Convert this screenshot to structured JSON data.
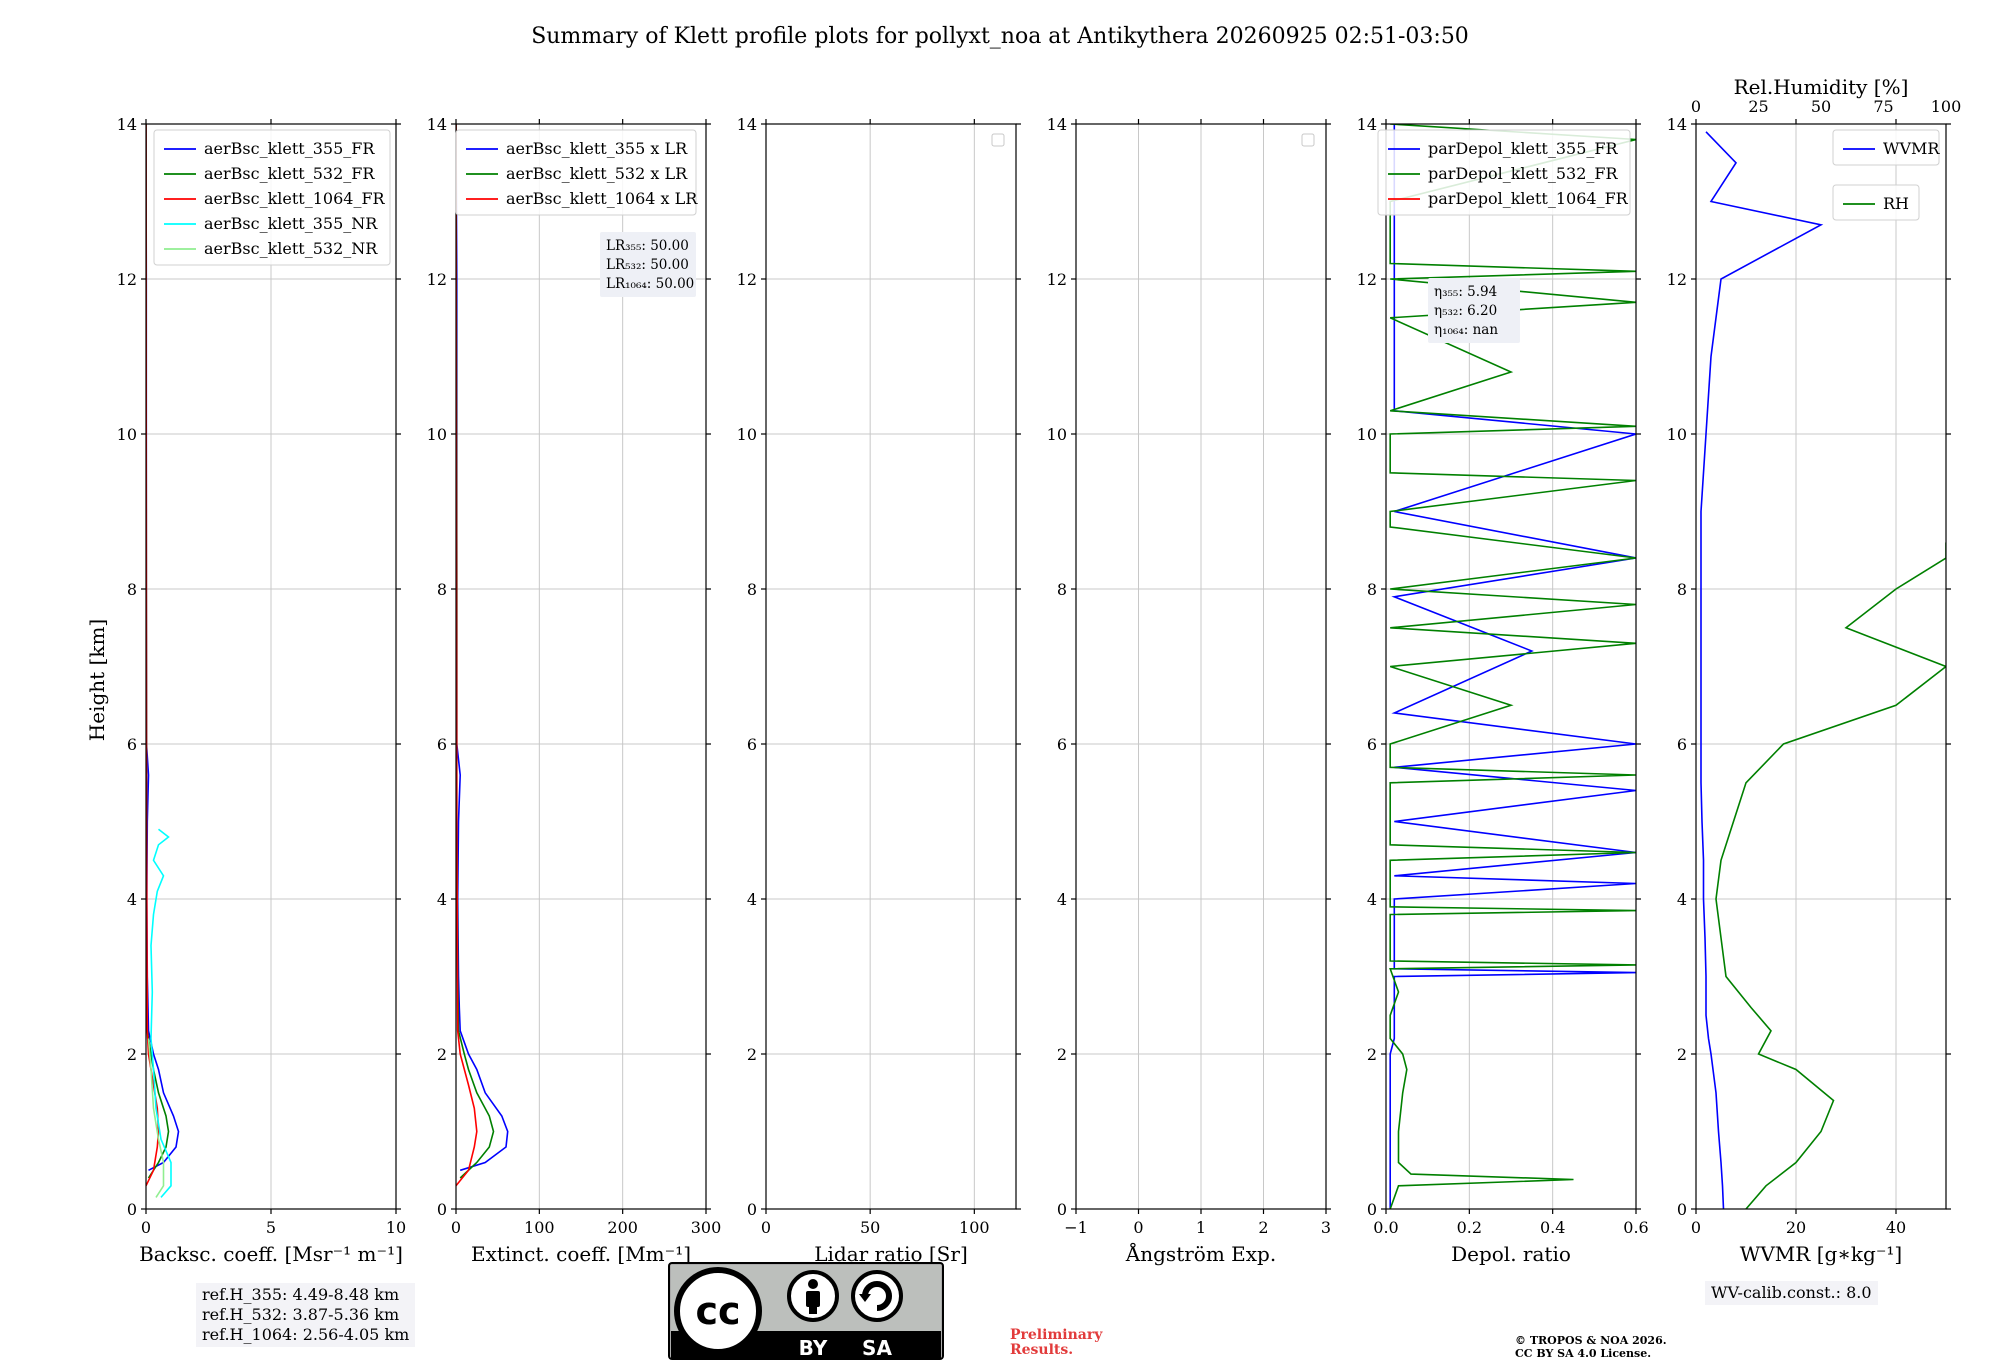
{
  "title": "Summary of Klett profile plots for pollyxt_noa at Antikythera 20260925 02:51-03:50",
  "colors": {
    "b355": "#0000ff",
    "g532": "#008000",
    "r1064": "#ff0000",
    "c355nr": "#00ffff",
    "lg532nr": "#90ee90"
  },
  "chart_data": [
    {
      "type": "line",
      "id": "backscatter",
      "xlabel": "Backsc. coeff. [Msr⁻¹ m⁻¹]",
      "ylabel": "Height [km]",
      "xlim": [
        0,
        10
      ],
      "ylim": [
        0,
        14
      ],
      "xticks": [
        0,
        5,
        10
      ],
      "xtick_labels": [
        "0",
        "5",
        "10"
      ],
      "yticks": [
        0,
        2,
        4,
        6,
        8,
        10,
        12,
        14
      ],
      "ytick_labels": [
        "0",
        "2",
        "4",
        "6",
        "8",
        "10",
        "12",
        "14"
      ],
      "grid": true,
      "legend_position": "top-right",
      "series": [
        {
          "name": "aerBsc_klett_355_FR",
          "color": "#0000ff",
          "y": [
            0.5,
            0.6,
            0.8,
            1.0,
            1.2,
            1.5,
            1.8,
            2.0,
            2.3,
            2.6,
            3.0,
            4.0,
            5.0,
            5.6,
            6.0,
            8.0,
            10.0,
            12.0,
            14.0
          ],
          "x": [
            0.1,
            0.7,
            1.2,
            1.3,
            1.1,
            0.7,
            0.5,
            0.3,
            0.1,
            0.08,
            0.05,
            0.03,
            0.05,
            0.1,
            0.02,
            0.01,
            0.01,
            0.01,
            0.0
          ]
        },
        {
          "name": "aerBsc_klett_532_FR",
          "color": "#008000",
          "y": [
            0.4,
            0.6,
            0.8,
            1.0,
            1.2,
            1.5,
            1.8,
            2.0,
            2.3,
            3.0,
            5.0,
            8.0,
            14.0
          ],
          "x": [
            0.1,
            0.5,
            0.8,
            0.9,
            0.8,
            0.5,
            0.3,
            0.2,
            0.05,
            0.03,
            0.02,
            0.01,
            0.0
          ]
        },
        {
          "name": "aerBsc_klett_1064_FR",
          "color": "#ff0000",
          "y": [
            0.3,
            0.5,
            0.8,
            1.0,
            1.3,
            1.6,
            2.0,
            2.3,
            5.0,
            14.0
          ],
          "x": [
            0.0,
            0.3,
            0.45,
            0.5,
            0.45,
            0.3,
            0.1,
            0.05,
            0.02,
            0.0
          ]
        },
        {
          "name": "aerBsc_klett_355_NR",
          "color": "#00ffff",
          "y": [
            0.15,
            0.3,
            0.6,
            0.9,
            1.3,
            1.8,
            2.2,
            2.8,
            3.4,
            3.8,
            4.1,
            4.3,
            4.5,
            4.7,
            4.8,
            4.9
          ],
          "x": [
            0.6,
            1.0,
            1.0,
            0.6,
            0.4,
            0.3,
            0.2,
            0.25,
            0.2,
            0.3,
            0.45,
            0.7,
            0.3,
            0.5,
            0.9,
            0.5
          ]
        },
        {
          "name": "aerBsc_klett_532_NR",
          "color": "#90ee90",
          "y": [
            0.15,
            0.3,
            0.6,
            0.9,
            1.3,
            1.8,
            2.2
          ],
          "x": [
            0.4,
            0.7,
            0.7,
            0.5,
            0.3,
            0.2,
            0.1
          ]
        }
      ]
    },
    {
      "type": "line",
      "id": "extinction",
      "xlabel": "Extinct. coeff. [Mm⁻¹]",
      "xlim": [
        0,
        300
      ],
      "ylim": [
        0,
        14
      ],
      "xticks": [
        0,
        100,
        200,
        300
      ],
      "xtick_labels": [
        "0",
        "100",
        "200",
        "300"
      ],
      "yticks": [
        0,
        2,
        4,
        6,
        8,
        10,
        12,
        14
      ],
      "ytick_labels": [
        "0",
        "2",
        "4",
        "6",
        "8",
        "10",
        "12",
        "14"
      ],
      "grid": true,
      "legend_position": "top-right",
      "series": [
        {
          "name": "aerBsc_klett_355 x LR",
          "color": "#0000ff",
          "y": [
            0.5,
            0.6,
            0.8,
            1.0,
            1.2,
            1.5,
            1.8,
            2.0,
            2.3,
            2.6,
            3.0,
            4.0,
            5.0,
            5.6,
            6.0,
            8.0,
            10.0,
            12.0,
            14.0
          ],
          "x": [
            5,
            35,
            60,
            62,
            55,
            35,
            25,
            15,
            5,
            4,
            3,
            2,
            3,
            5,
            1,
            1,
            1,
            1,
            0
          ]
        },
        {
          "name": "aerBsc_klett_532 x LR",
          "color": "#008000",
          "y": [
            0.4,
            0.6,
            0.8,
            1.0,
            1.2,
            1.5,
            1.8,
            2.0,
            2.3,
            3.0,
            5.0,
            8.0,
            14.0
          ],
          "x": [
            5,
            25,
            40,
            45,
            40,
            25,
            15,
            10,
            3,
            2,
            1,
            1,
            0
          ]
        },
        {
          "name": "aerBsc_klett_1064 x LR",
          "color": "#ff0000",
          "y": [
            0.3,
            0.5,
            0.8,
            1.0,
            1.3,
            1.6,
            2.0,
            2.3,
            5.0,
            14.0
          ],
          "x": [
            0,
            15,
            22,
            25,
            22,
            15,
            5,
            2,
            1,
            0
          ]
        }
      ],
      "annotation": [
        "LR₃₅₅: 50.00",
        "LR₅₃₂: 50.00",
        "LR₁₀₆₄: 50.00"
      ]
    },
    {
      "type": "line",
      "id": "lidar-ratio",
      "xlabel": "Lidar ratio [Sr]",
      "xlim": [
        0,
        120
      ],
      "ylim": [
        0,
        14
      ],
      "xticks": [
        0,
        50,
        100
      ],
      "xtick_labels": [
        "0",
        "50",
        "100"
      ],
      "yticks": [
        0,
        2,
        4,
        6,
        8,
        10,
        12,
        14
      ],
      "ytick_labels": [
        "0",
        "2",
        "4",
        "6",
        "8",
        "10",
        "12",
        "14"
      ],
      "grid": true,
      "series": []
    },
    {
      "type": "line",
      "id": "angstrom",
      "xlabel": "Ångström Exp.",
      "xlim": [
        -1,
        3
      ],
      "ylim": [
        0,
        14
      ],
      "xticks": [
        -1,
        0,
        1,
        2,
        3
      ],
      "xtick_labels": [
        "−1",
        "0",
        "1",
        "2",
        "3"
      ],
      "yticks": [
        0,
        2,
        4,
        6,
        8,
        10,
        12,
        14
      ],
      "ytick_labels": [
        "0",
        "2",
        "4",
        "6",
        "8",
        "10",
        "12",
        "14"
      ],
      "grid": true,
      "series": []
    },
    {
      "type": "line",
      "id": "depol",
      "xlabel": "Depol. ratio",
      "xlim": [
        0,
        0.6
      ],
      "ylim": [
        0,
        14
      ],
      "xticks": [
        0,
        0.2,
        0.4,
        0.6
      ],
      "xtick_labels": [
        "0.0",
        "0.2",
        "0.4",
        "0.6"
      ],
      "yticks": [
        0,
        2,
        4,
        6,
        8,
        10,
        12,
        14
      ],
      "ytick_labels": [
        "0",
        "2",
        "4",
        "6",
        "8",
        "10",
        "12",
        "14"
      ],
      "grid": true,
      "legend_position": "top-right",
      "series": [
        {
          "name": "parDepol_klett_355_FR",
          "color": "#0000ff",
          "y": [
            0.0,
            0.5,
            1.0,
            2.0,
            2.2,
            3.0,
            3.05,
            3.1,
            4.0,
            4.2,
            4.3,
            4.6,
            5.0,
            5.4,
            5.7,
            6.0,
            6.4,
            7.2,
            7.9,
            8.4,
            9.0,
            10.0,
            10.3,
            11.0,
            12.0,
            13.0,
            14.0
          ],
          "x": [
            0.01,
            0.01,
            0.01,
            0.01,
            0.02,
            0.02,
            0.6,
            0.02,
            0.02,
            0.6,
            0.02,
            0.6,
            0.02,
            0.6,
            0.02,
            0.6,
            0.02,
            0.35,
            0.02,
            0.6,
            0.02,
            0.6,
            0.02,
            0.02,
            0.02,
            0.02,
            0.02
          ]
        },
        {
          "name": "parDepol_klett_532_FR",
          "color": "#008000",
          "y": [
            0.0,
            0.3,
            0.38,
            0.45,
            0.6,
            1.0,
            1.5,
            1.8,
            2.0,
            2.2,
            2.5,
            2.8,
            3.1,
            3.15,
            3.2,
            3.8,
            3.85,
            3.9,
            4.5,
            4.6,
            4.7,
            5.5,
            5.6,
            5.7,
            6.0,
            6.5,
            7.0,
            7.3,
            7.5,
            7.8,
            8.0,
            8.4,
            8.8,
            9.0,
            9.4,
            9.5,
            10.0,
            10.1,
            10.3,
            10.8,
            11.5,
            11.7,
            12.0,
            12.1,
            12.2,
            13.0,
            13.8,
            14.0
          ],
          "x": [
            0.01,
            0.03,
            0.45,
            0.06,
            0.03,
            0.03,
            0.04,
            0.05,
            0.04,
            0.01,
            0.01,
            0.03,
            0.01,
            0.6,
            0.01,
            0.01,
            0.6,
            0.01,
            0.01,
            0.6,
            0.01,
            0.01,
            0.6,
            0.01,
            0.01,
            0.3,
            0.01,
            0.6,
            0.01,
            0.6,
            0.01,
            0.6,
            0.01,
            0.01,
            0.6,
            0.01,
            0.01,
            0.6,
            0.01,
            0.3,
            0.01,
            0.6,
            0.01,
            0.6,
            0.01,
            0.01,
            0.6,
            0.01
          ]
        }
      ],
      "annotation": [
        "η₃₅₅: 5.94",
        "η₅₃₂: 6.20",
        "η₁₀₆₄: nan"
      ],
      "legend_extra": "parDepol_klett_1064_FR"
    },
    {
      "type": "line",
      "id": "wvmr",
      "xlabel": "WVMR [g∗kg⁻¹]",
      "xlim": [
        0,
        50
      ],
      "ylim": [
        0,
        14
      ],
      "xticks": [
        0,
        20,
        40
      ],
      "xtick_labels": [
        "0",
        "20",
        "40"
      ],
      "yticks": [
        0,
        2,
        4,
        6,
        8,
        10,
        12,
        14
      ],
      "ytick_labels": [
        "0",
        "2",
        "4",
        "6",
        "8",
        "10",
        "12",
        "14"
      ],
      "top_xlabel": "Rel.Humidity [%]",
      "top_xlim": [
        0,
        100
      ],
      "top_xticks": [
        0,
        25,
        50,
        75,
        100
      ],
      "top_xtick_labels": [
        "0",
        "25",
        "50",
        "75",
        "100"
      ],
      "grid": true,
      "series": [
        {
          "name": "WVMR",
          "color": "#0000ff",
          "axis": "bottom",
          "y": [
            0.0,
            0.3,
            0.6,
            1.0,
            1.5,
            2.0,
            2.2,
            2.5,
            3.0,
            3.5,
            4.0,
            4.5,
            5.0,
            5.5,
            6.0,
            7.0,
            8.0,
            9.0,
            10.0,
            11.0,
            12.0,
            12.7,
            13.0,
            13.5,
            13.9
          ],
          "x": [
            5.5,
            5.3,
            5.0,
            4.5,
            4.0,
            3.0,
            2.5,
            2.0,
            2.0,
            1.8,
            1.5,
            1.5,
            1.2,
            1.0,
            1.0,
            1.0,
            1.0,
            1.0,
            2.0,
            3.0,
            5.0,
            25.0,
            3.0,
            8.0,
            2.0
          ]
        },
        {
          "name": "RH",
          "color": "#008000",
          "axis": "top",
          "y": [
            0.0,
            0.3,
            0.6,
            1.0,
            1.4,
            1.8,
            2.0,
            2.3,
            2.6,
            3.0,
            3.5,
            4.0,
            4.5,
            5.0,
            5.5,
            6.0,
            6.5,
            7.0,
            7.5,
            8.0,
            8.4,
            8.6
          ],
          "x": [
            20,
            28,
            40,
            50,
            55,
            40,
            25,
            30,
            22,
            12,
            10,
            8,
            10,
            15,
            20,
            35,
            80,
            100,
            60,
            80,
            100,
            100
          ]
        }
      ]
    }
  ],
  "legends": {
    "backscatter": [
      "aerBsc_klett_355_FR",
      "aerBsc_klett_532_FR",
      "aerBsc_klett_1064_FR",
      "aerBsc_klett_355_NR",
      "aerBsc_klett_532_NR"
    ],
    "extinction": [
      "aerBsc_klett_355 x LR",
      "aerBsc_klett_532 x LR",
      "aerBsc_klett_1064 x LR"
    ],
    "depol": [
      "parDepol_klett_355_FR",
      "parDepol_klett_532_FR",
      "parDepol_klett_1064_FR"
    ],
    "wvmr": "WVMR",
    "rh": "RH"
  },
  "annotations": {
    "lr": [
      "LR₃₅₅: 50.00",
      "LR₅₃₂: 50.00",
      "LR₁₀₆₄: 50.00"
    ],
    "eta": [
      "η₃₅₅: 5.94",
      "η₅₃₂: 6.20",
      "η₁₀₆₄: nan"
    ]
  },
  "footer": {
    "ref_h": [
      "ref.H_355: 4.49-8.48 km",
      "ref.H_532: 3.87-5.36 km",
      "ref.H_1064: 2.56-4.05 km"
    ],
    "wv_calib": "WV-calib.const.: 8.0",
    "preliminary": [
      "Preliminary",
      "Results."
    ],
    "copyright": [
      "© TROPOS & NOA 2026.",
      "CC BY SA 4.0 License."
    ],
    "license": {
      "cc": "cc",
      "by": "BY",
      "sa": "SA"
    }
  }
}
